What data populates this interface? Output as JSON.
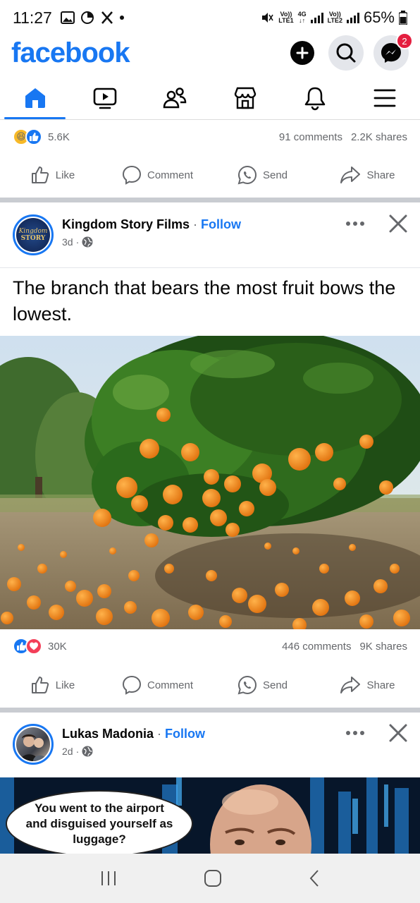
{
  "status": {
    "time": "11:27",
    "battery": "65%",
    "net1_top": "Vo))",
    "net1_bottom": "LTE1",
    "net_4g": "4G",
    "net2_top": "Vo))",
    "net2_bottom": "LTE2"
  },
  "header": {
    "logo": "facebook",
    "messenger_badge": "2"
  },
  "tabs": [
    "home",
    "video",
    "friends",
    "marketplace",
    "notifications",
    "menu"
  ],
  "post0": {
    "reactions_count": "5.6K",
    "comments": "91 comments",
    "shares": "2.2K shares"
  },
  "actions": {
    "like": "Like",
    "comment": "Comment",
    "send": "Send",
    "share": "Share"
  },
  "post1": {
    "author": "Kingdom Story Films",
    "follow": "Follow",
    "time": "3d",
    "avatar_text_1": "Kingdom",
    "avatar_text_2": "STORY",
    "text": "The branch that bears the most fruit bows the lowest.",
    "reactions_count": "30K",
    "comments": "446 comments",
    "shares": "9K shares"
  },
  "post2": {
    "author": "Lukas Madonia",
    "follow": "Follow",
    "time": "2d",
    "bubble_text": "You went to the airport and disguised yourself as luggage?"
  },
  "colors": {
    "brand": "#1877F2",
    "badge": "#E41E3F",
    "divider": "#C9CCD1"
  }
}
